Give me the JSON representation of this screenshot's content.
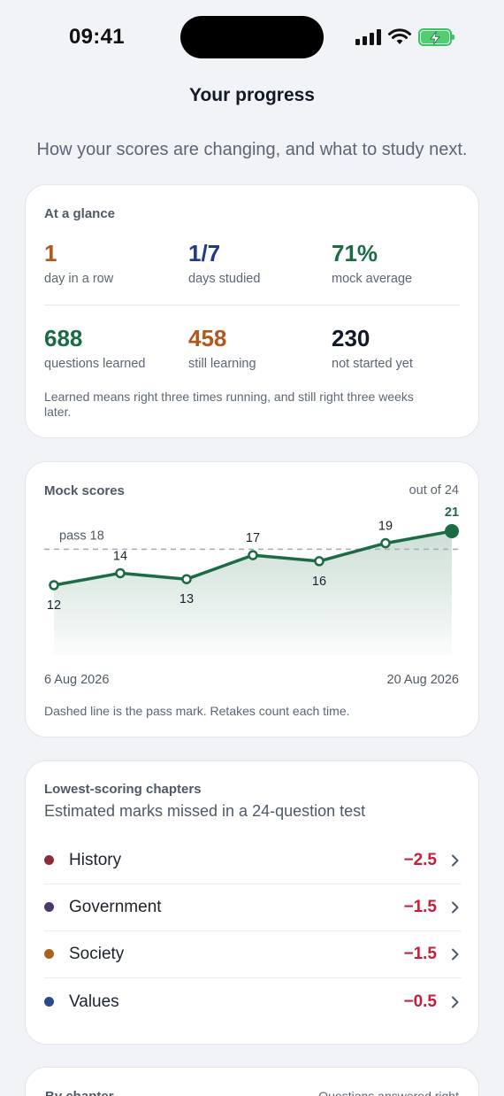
{
  "status_bar": {
    "time": "09:41"
  },
  "header": {
    "title": "Your progress",
    "subtitle": "How your scores are changing, and what to study next."
  },
  "glance": {
    "label": "At a glance",
    "stats": [
      {
        "value": "1",
        "label": "day in a row",
        "color": "#b5561a"
      },
      {
        "value": "1/7",
        "label": "days studied",
        "color": "#1e3a8a"
      },
      {
        "value": "71%",
        "label": "mock average",
        "color": "#1b6b45"
      },
      {
        "value": "688",
        "label": "questions learned",
        "color": "#1b6b45"
      },
      {
        "value": "458",
        "label": "still learning",
        "color": "#b5561a"
      },
      {
        "value": "230",
        "label": "not started yet",
        "color": "#111827"
      }
    ],
    "note": "Learned means right three times running, and still right three weeks later."
  },
  "mock_scores": {
    "label": "Mock scores",
    "out_of_label": "out of 24",
    "pass_label": "pass 18",
    "start_date": "6 Aug 2026",
    "end_date": "20 Aug 2026",
    "note": "Dashed line is the pass mark. Retakes count each time.",
    "line_color": "#1b6b45"
  },
  "chart_data": {
    "type": "line",
    "x": [
      1,
      2,
      3,
      4,
      5,
      6,
      7
    ],
    "series": [
      {
        "values": [
          12,
          14,
          13,
          17,
          16,
          19,
          21
        ]
      }
    ],
    "pass_mark": 18,
    "ylim": [
      0,
      24
    ],
    "x_start_label": "6 Aug 2026",
    "x_end_label": "20 Aug 2026",
    "grid": false
  },
  "chapters": {
    "label": "Lowest-scoring chapters",
    "description": "Estimated marks missed in a 24-question test",
    "items": [
      {
        "name": "History",
        "value": "−2.5",
        "color": "#8b2e3c"
      },
      {
        "name": "Government",
        "value": "−1.5",
        "color": "#4a3a6b"
      },
      {
        "name": "Society",
        "value": "−1.5",
        "color": "#a8641c"
      },
      {
        "name": "Values",
        "value": "−0.5",
        "color": "#2a4a8a"
      }
    ],
    "chevron_icon": "chevron-right-icon"
  },
  "by_chapter": {
    "label": "By chapter",
    "right_label": "Questions answered right"
  }
}
